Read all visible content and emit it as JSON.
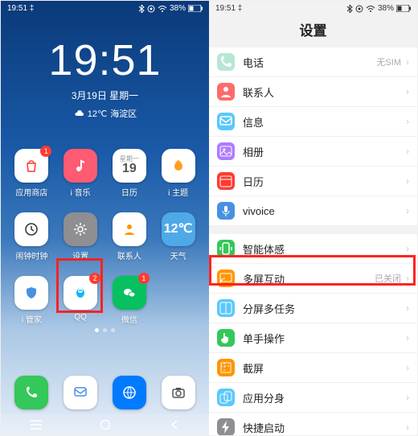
{
  "status": {
    "time": "19:51",
    "battery_pct": "38%",
    "bt_icon": "bluetooth",
    "nfc_icon": "nfc",
    "wifi_icon": "wifi"
  },
  "home": {
    "clock_time": "19:51",
    "date_line": "3月19日  星期一",
    "temp": "12℃",
    "location": "海淀区",
    "apps_row1": [
      {
        "label": "应用商店",
        "icon": "bag",
        "bg": "#ffffff",
        "fg": "#ff3b30",
        "badge": "1"
      },
      {
        "label": "i 音乐",
        "icon": "music",
        "bg": "#ff5b72",
        "fg": "#ffffff"
      },
      {
        "label": "日历",
        "icon": "calendar",
        "bg": "#ffffff",
        "fg": "#555",
        "text": "19",
        "sub": "星期一"
      },
      {
        "label": "i 主题",
        "icon": "theme",
        "bg": "#ffffff",
        "fg": "#ff9f1c"
      }
    ],
    "apps_row2": [
      {
        "label": "闹钟时钟",
        "icon": "clock",
        "bg": "#ffffff",
        "fg": "#333"
      },
      {
        "label": "设置",
        "icon": "gear",
        "bg": "#8e8e93",
        "fg": "#ffffff"
      },
      {
        "label": "联系人",
        "icon": "contacts",
        "bg": "#ffffff",
        "fg": "#ff9500"
      },
      {
        "label": "天气",
        "icon": "weather",
        "bg": "#4fa9e8",
        "fg": "#ffffff",
        "text": "12℃"
      }
    ],
    "apps_row3": [
      {
        "label": "i 管家",
        "icon": "shield",
        "bg": "#ffffff",
        "fg": "#4a90e2"
      },
      {
        "label": "QQ",
        "icon": "qq",
        "bg": "#ffffff",
        "fg": "#12b7f5",
        "badge": "2"
      },
      {
        "label": "微信",
        "icon": "wechat",
        "bg": "#07c160",
        "fg": "#ffffff",
        "badge": "1"
      },
      {
        "label": "",
        "icon": "none",
        "bg": "transparent"
      }
    ],
    "dock": [
      {
        "label": "",
        "icon": "phone",
        "bg": "#34c759",
        "fg": "#ffffff"
      },
      {
        "label": "",
        "icon": "sms",
        "bg": "#ffffff",
        "fg": "#4a90e2"
      },
      {
        "label": "",
        "icon": "browser",
        "bg": "#007aff",
        "fg": "#ffffff"
      },
      {
        "label": "",
        "icon": "camera",
        "bg": "#ffffff",
        "fg": "#555"
      }
    ]
  },
  "settings": {
    "title": "设置",
    "rows": [
      {
        "label": "电话",
        "value": "无SIM",
        "icon_bg": "#b8e6d2",
        "icon": "phone",
        "gap": false
      },
      {
        "label": "联系人",
        "value": "",
        "icon_bg": "#ff6b6b",
        "icon": "contacts",
        "gap": false
      },
      {
        "label": "信息",
        "value": "",
        "icon_bg": "#5ac8fa",
        "icon": "sms",
        "gap": false
      },
      {
        "label": "相册",
        "value": "",
        "icon_bg": "#af7bff",
        "icon": "gallery",
        "gap": false
      },
      {
        "label": "日历",
        "value": "",
        "icon_bg": "#ff3b30",
        "icon": "calendar",
        "gap": false
      },
      {
        "label": "vivoice",
        "value": "",
        "icon_bg": "#4a90e2",
        "icon": "voice",
        "gap": false
      },
      {
        "label": "智能体感",
        "value": "",
        "icon_bg": "#34c759",
        "icon": "motion",
        "gap": true,
        "highlighted": true
      },
      {
        "label": "多屏互动",
        "value": "已关闭",
        "icon_bg": "#ff9500",
        "icon": "cast",
        "gap": false
      },
      {
        "label": "分屏多任务",
        "value": "",
        "icon_bg": "#5ac8fa",
        "icon": "split",
        "gap": false
      },
      {
        "label": "单手操作",
        "value": "",
        "icon_bg": "#34c759",
        "icon": "onehand",
        "gap": false
      },
      {
        "label": "截屏",
        "value": "",
        "icon_bg": "#ff9500",
        "icon": "screenshot",
        "gap": false
      },
      {
        "label": "应用分身",
        "value": "",
        "icon_bg": "#5ac8fa",
        "icon": "clone",
        "gap": false
      },
      {
        "label": "快捷启动",
        "value": "",
        "icon_bg": "#8e8e93",
        "icon": "quick",
        "gap": false
      }
    ]
  }
}
